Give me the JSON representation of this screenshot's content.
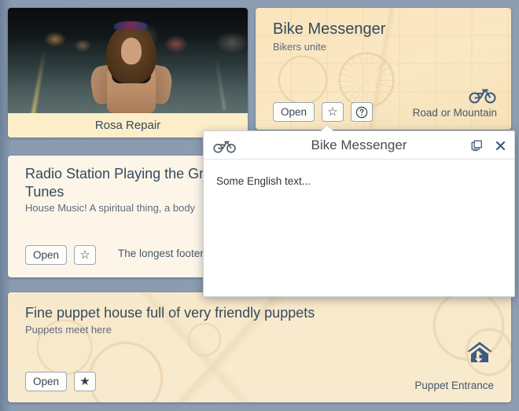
{
  "theme": {
    "background": "#8b9cb0",
    "card_cream": "#fae7c1",
    "card_light": "#fdf6e8",
    "card_beige": "#f8e9cb",
    "text_dark": "#34495e",
    "text_muted": "#5c6b7d",
    "accent_blue": "#3d5a80",
    "dialog_bg": "#ffffff"
  },
  "cards": {
    "rosa": {
      "caption": "Rosa Repair",
      "image_name": "woman-on-night-street-photo"
    },
    "bike": {
      "title": "Bike Messenger",
      "subtitle": "Bikers unite",
      "open_label": "Open",
      "star_glyph": "☆",
      "help_glyph": "?",
      "footer_text": "Road or Mountain",
      "footer_icon": "bicycle-icon"
    },
    "radio": {
      "title": "Radio Station Playing the Gro\nTunes",
      "subtitle": "House Music! A spiritual thing, a body",
      "open_label": "Open",
      "star_glyph": "☆",
      "footer_text": "The longest footer"
    },
    "puppet": {
      "title": "Fine puppet house full of very friendly puppets",
      "subtitle": "Puppets meet here",
      "open_label": "Open",
      "star_glyph": "★",
      "footer_text": "Puppet Entrance",
      "footer_icon": "home-entrance-icon"
    }
  },
  "dialog": {
    "icon": "bicycle-icon",
    "title": "Bike Messenger",
    "restore_icon": "restore-window-icon",
    "close_icon": "close-icon",
    "close_glyph": "✕",
    "body_text": "Some English text..."
  }
}
